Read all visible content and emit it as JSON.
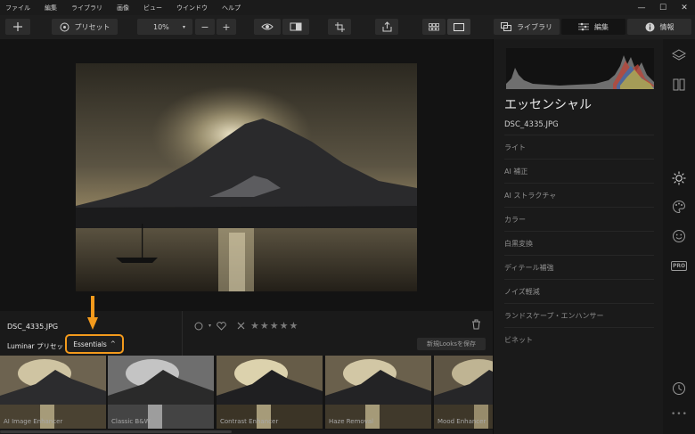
{
  "menubar": {
    "items": [
      "ファイル",
      "編集",
      "ライブラリ",
      "画像",
      "ビュー",
      "ウインドウ",
      "ヘルプ"
    ],
    "window_controls": [
      "—",
      "☐",
      "✕"
    ]
  },
  "toolbar": {
    "add_icon": "plus-icon",
    "presets_label": "プリセット",
    "zoom_value": "10%",
    "zoom_out": "−",
    "zoom_in": "+",
    "library_tab": "ライブラリ",
    "edit_tab": "編集",
    "info_tab": "情報"
  },
  "info": {
    "filename": "DSC_4335.JPG",
    "luminar_presets_label": "Luminar プリセット",
    "essentials_dropdown": "Essentials",
    "dropdown_chevron": "^",
    "stars": "★★★★★",
    "save_looks_button": "新規Looksを保存",
    "flag_icon": "circle-icon",
    "heart_icon": "heart-icon",
    "reject_icon": "x-icon"
  },
  "filmstrip": {
    "items": [
      {
        "label": "AI Image Enhancer"
      },
      {
        "label": "Classic B&W"
      },
      {
        "label": "Contrast Enhancer"
      },
      {
        "label": "Haze Removal"
      },
      {
        "label": "Mood Enhancer"
      }
    ]
  },
  "right_panel": {
    "title": "エッセンシャル",
    "filename": "DSC_4335.JPG",
    "tools": [
      "ライト",
      "AI 補正",
      "AI ストラクチャ",
      "カラー",
      "白黒変換",
      "ディテール補強",
      "ノイズ軽減",
      "ランドスケープ・エンハンサー",
      "ビネット"
    ]
  },
  "side_icons": {
    "pro_label": "PRO",
    "more_label": "•••"
  },
  "colors": {
    "highlight": "#f39a1c",
    "background": "#131313",
    "panel": "#1a1a1a"
  }
}
